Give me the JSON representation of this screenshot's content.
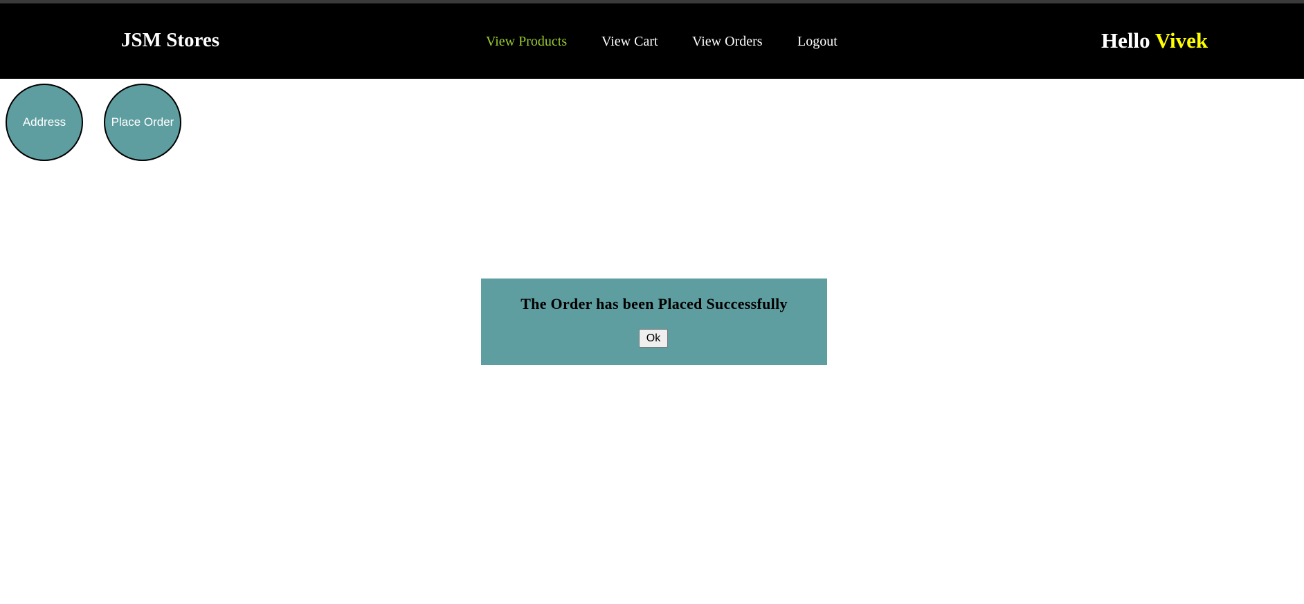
{
  "header": {
    "brand": "JSM Stores",
    "nav": [
      {
        "label": "View Products",
        "active": true
      },
      {
        "label": "View Cart",
        "active": false
      },
      {
        "label": "View Orders",
        "active": false
      },
      {
        "label": "Logout",
        "active": false
      }
    ],
    "greeting_prefix": "Hello",
    "user_name": "Vivek"
  },
  "steps": {
    "address": "Address",
    "place_order": "Place Order"
  },
  "dialog": {
    "message": "The Order has been Placed Successfully",
    "ok_label": "Ok"
  },
  "colors": {
    "navbar_bg": "#000000",
    "nav_active": "#9acd32",
    "user_name": "#ffff00",
    "accent_teal": "#5f9ea0"
  }
}
